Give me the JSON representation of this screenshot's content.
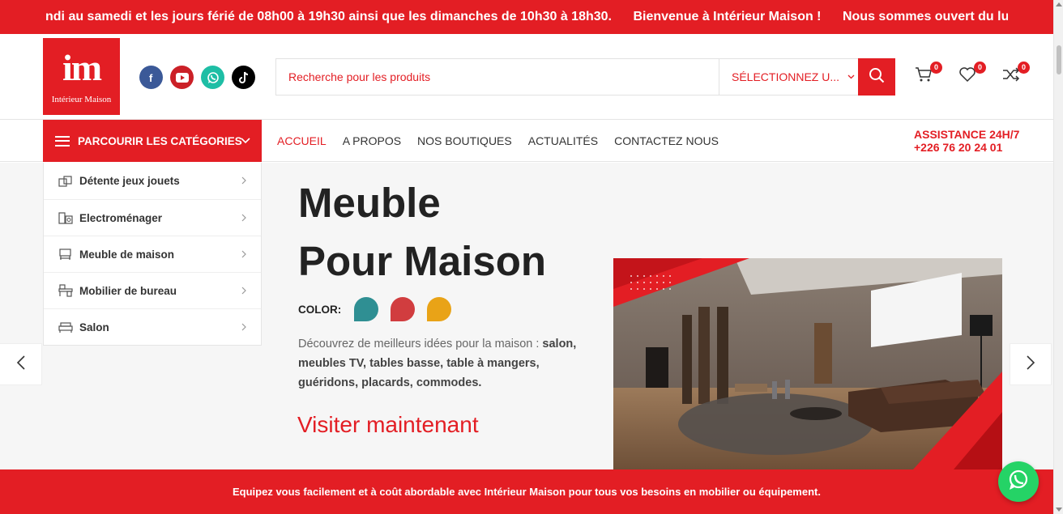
{
  "topbar": {
    "messages": [
      "ndi au samedi et les jours férié de 08h00 à 19h30 ainsi que les dimanches de 10h30 à 18h30.",
      "Bienvenue à Intérieur Maison !",
      "Nous sommes ouvert du lu"
    ],
    "color": "#e31e24"
  },
  "logo": {
    "mark": "im",
    "name": "Intérieur Maison"
  },
  "socials": {
    "facebook": "f",
    "youtube": "youtube-icon",
    "whatsapp": "whatsapp-icon",
    "tiktok": "tiktok-icon"
  },
  "search": {
    "placeholder": "Recherche pour les produits",
    "category_select": "SÉLECTIONNEZ U..."
  },
  "header_icons": {
    "cart_count": "0",
    "wishlist_count": "0",
    "compare_count": "0"
  },
  "nav": {
    "categories_button": "PARCOURIR LES CATÉGORIES",
    "items": [
      {
        "label": "ACCUEIL",
        "active": true
      },
      {
        "label": "A PROPOS",
        "active": false
      },
      {
        "label": "NOS BOUTIQUES",
        "active": false
      },
      {
        "label": "ACTUALITÉS",
        "active": false
      },
      {
        "label": "CONTACTEZ NOUS",
        "active": false
      }
    ],
    "assistance_label": "ASSISTANCE 24H/7",
    "assistance_phone": "+226 76 20 24 01"
  },
  "categories": [
    {
      "label": "Détente jeux jouets",
      "icon": "toys-icon"
    },
    {
      "label": "Electroménager",
      "icon": "appliance-icon"
    },
    {
      "label": "Meuble de maison",
      "icon": "furniture-icon"
    },
    {
      "label": "Mobilier de bureau",
      "icon": "office-furniture-icon"
    },
    {
      "label": "Salon",
      "icon": "salon-icon"
    }
  ],
  "hero": {
    "title_line1": "Meuble",
    "title_line2": "Pour Maison",
    "color_label": "COLOR:",
    "swatches": [
      "#2f8f93",
      "#d13d3f",
      "#e9a317"
    ],
    "desc_plain": "Découvrez de meilleurs idées pour la maison : ",
    "desc_bold": "salon, meubles TV, tables basse, table à mangers, guéridons, placards, commodes.",
    "cta": "Visiter maintenant"
  },
  "footer_banner": "Equipez vous facilement et à coût abordable avec Intérieur Maison pour tous vos besoins en mobilier ou équipement."
}
